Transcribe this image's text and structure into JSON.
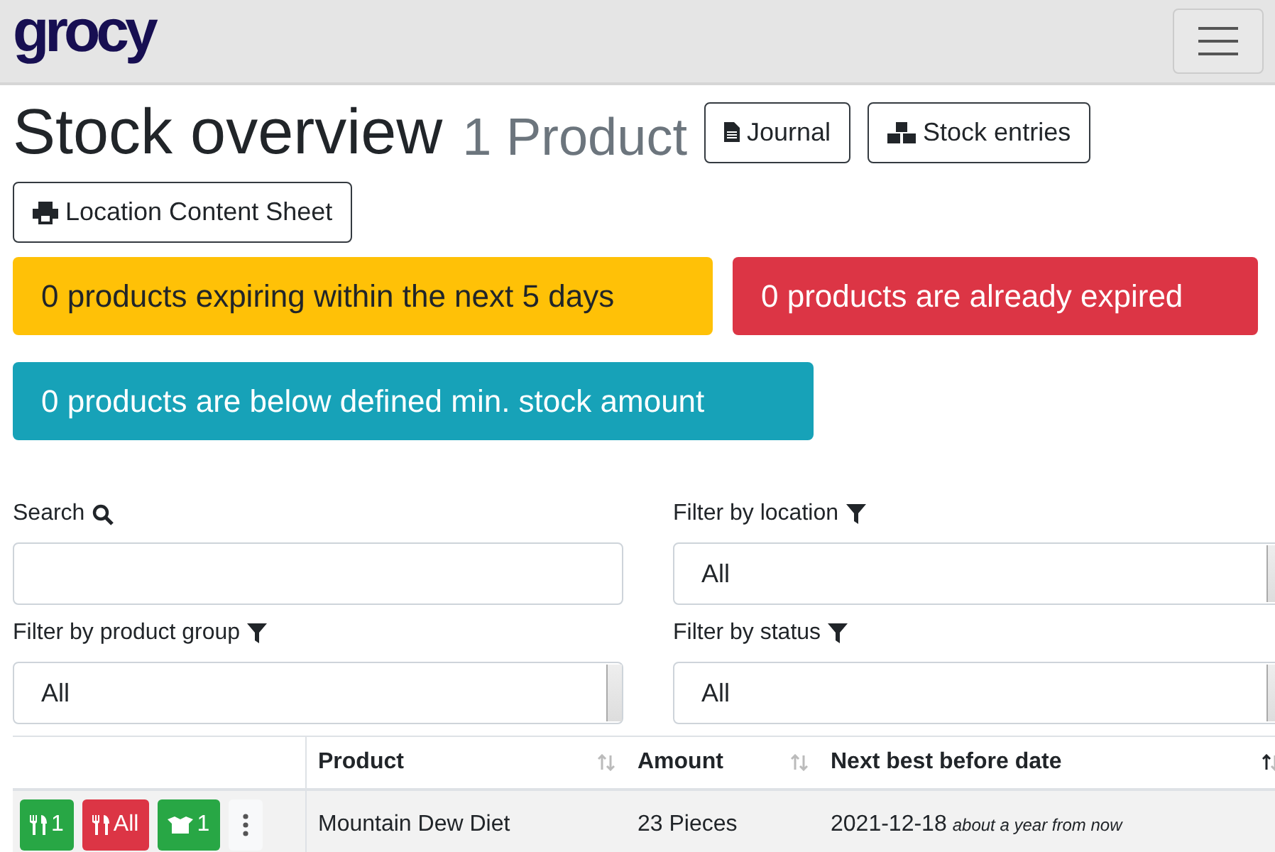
{
  "navbar": {
    "logo": "grocy"
  },
  "header": {
    "title": "Stock overview",
    "subtitle": "1 Product",
    "buttons": [
      {
        "kind": "journal",
        "label": "Journal"
      },
      {
        "kind": "entries",
        "label": "Stock entries"
      },
      {
        "kind": "print",
        "label": "Location Content Sheet"
      }
    ]
  },
  "alerts": [
    {
      "kind": "warning",
      "text": "0 products expiring within the next 5 days"
    },
    {
      "kind": "danger",
      "text": "0 products are already expired"
    },
    {
      "kind": "info",
      "text": "0 products are below defined min. stock amount"
    }
  ],
  "filters": [
    {
      "kind": "search",
      "label": "Search"
    },
    {
      "kind": "select",
      "label": "Filter by location",
      "value": "All"
    },
    {
      "kind": "select",
      "label": "Filter by product group",
      "value": "All"
    },
    {
      "kind": "select",
      "label": "Filter by status",
      "value": "All"
    }
  ],
  "table": {
    "columns": [
      {
        "label": "Product",
        "sorted": false
      },
      {
        "label": "Amount",
        "sorted": false
      },
      {
        "label": "Next best before date",
        "sorted": true
      }
    ],
    "rows": [
      {
        "actions": [
          {
            "kind": "consume",
            "label": "1"
          },
          {
            "kind": "consume-all",
            "label": "All"
          },
          {
            "kind": "open",
            "label": "1"
          },
          {
            "kind": "more"
          }
        ],
        "product": "Mountain Dew Diet",
        "amount": "23 Pieces",
        "date": "2021-12-18",
        "relative": "about a year from now"
      }
    ]
  }
}
